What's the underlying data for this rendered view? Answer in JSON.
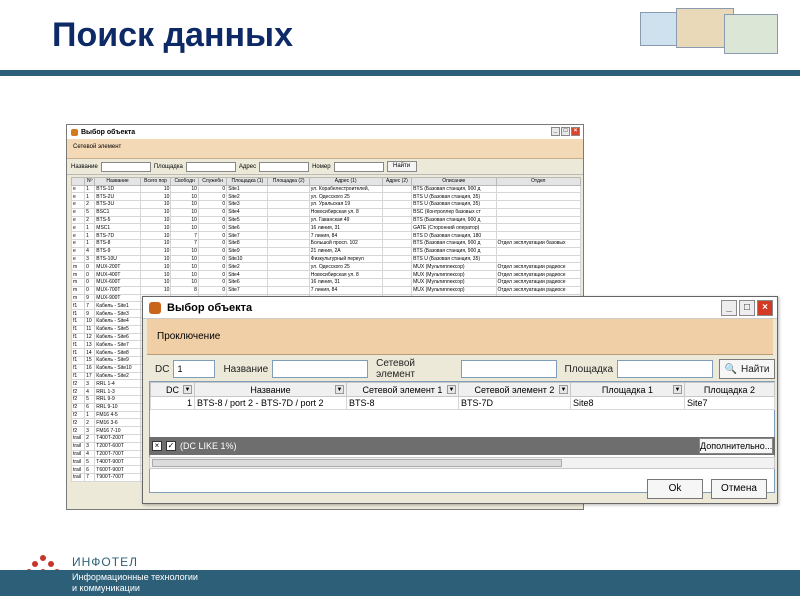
{
  "slide": {
    "title": "Поиск данных"
  },
  "bg_window": {
    "title": "Выбор объекта",
    "subheader": "Сетевой элемент",
    "filters": {
      "name_label": "Название",
      "site_label": "Площадка",
      "address_label": "Адрес",
      "number_label": "Номер",
      "search_label": "Найти"
    },
    "columns": [
      "",
      "Nº",
      "Название",
      "Всего пор",
      "Свободн",
      "Служебн",
      "Площадка (1)",
      "Площадка (2)",
      "Адрес (1)",
      "Адрес (2)",
      "Описание",
      "Отдел"
    ],
    "rows": [
      [
        "e",
        "1",
        "BTS-1D",
        "10",
        "10",
        "0",
        "Site1",
        "",
        "ул. Корабелестроителей,",
        "",
        "BTS (Базовая станция, 900 д",
        ""
      ],
      [
        "e",
        "1",
        "BTS-2U",
        "10",
        "10",
        "0",
        "Site2",
        "",
        "ул. Одесского 25",
        "",
        "BTS U (Базовая станция, 35)",
        ""
      ],
      [
        "e",
        "2",
        "BTS-3U",
        "10",
        "10",
        "0",
        "Site3",
        "",
        "ул. Уральская 19",
        "",
        "BTS U (Базовая станция, 35)",
        ""
      ],
      [
        "e",
        "5",
        "BSC1",
        "10",
        "10",
        "0",
        "Site4",
        "",
        "Новосибирская ул. 8",
        "",
        "BSC (Контроллер базовых ст",
        ""
      ],
      [
        "e",
        "2",
        "BTS-5",
        "10",
        "10",
        "0",
        "Site5",
        "",
        "ул. Гаванская 49",
        "",
        "BTS (Базовая станция, 900 д",
        ""
      ],
      [
        "e",
        "1",
        "MSC1",
        "10",
        "10",
        "0",
        "Site6",
        "",
        "16 линия, 31",
        "",
        "GATE (Сторонний оператор)",
        ""
      ],
      [
        "e",
        "1",
        "BTS-7D",
        "10",
        "7",
        "0",
        "Site7",
        "",
        "7 линия, 84",
        "",
        "BTS D (Базовая станция, 180",
        ""
      ],
      [
        "e",
        "1",
        "BTS-8",
        "10",
        "7",
        "0",
        "Site8",
        "",
        "Большой просп. 102",
        "",
        "BTS (Базовая станция, 900 д",
        "Отдел эксплуатации базовых"
      ],
      [
        "e",
        "4",
        "BTS-9",
        "10",
        "10",
        "0",
        "Site9",
        "",
        "21 линия, 2А",
        "",
        "BTS (Базовая станция, 900 д",
        ""
      ],
      [
        "e",
        "3",
        "BTS-10U",
        "10",
        "10",
        "0",
        "Site10",
        "",
        "Физкультурный переул",
        "",
        "BTS U (Базовая станция, 35)",
        ""
      ],
      [
        "m",
        "0",
        "MUX-200Т",
        "10",
        "10",
        "0",
        "Site2",
        "",
        "ул. Одесского 25",
        "",
        "MUX (Мультиплексор)",
        "Отдел эксплуатации радиосе"
      ],
      [
        "m",
        "0",
        "MUX-400Т",
        "10",
        "10",
        "0",
        "Site4",
        "",
        "Новосибирская ул. 8",
        "",
        "MUX (Мультиплексор)",
        "Отдел эксплуатации радиосе"
      ],
      [
        "m",
        "0",
        "MUX-600Т",
        "10",
        "10",
        "0",
        "Site6",
        "",
        "16 линия, 31",
        "",
        "MUX (Мультиплексор)",
        "Отдел эксплуатации радиосе"
      ],
      [
        "m",
        "0",
        "MUX-700Т",
        "10",
        "8",
        "0",
        "Site7",
        "",
        "7 линия, 84",
        "",
        "MUX (Мультиплексор)",
        "Отдел эксплуатации радиосе"
      ],
      [
        "m",
        "9",
        "MUX-900Т",
        "",
        "",
        "",
        "",
        "",
        "",
        "",
        "",
        ""
      ],
      [
        "f1",
        "7",
        "Кабель - Site1",
        "",
        "",
        "",
        "",
        "",
        "",
        "",
        "",
        ""
      ],
      [
        "f1",
        "9",
        "Кабель - Site3",
        "",
        "",
        "",
        "",
        "",
        "",
        "",
        "",
        ""
      ],
      [
        "f1",
        "10",
        "Кабель - Site4",
        "",
        "",
        "",
        "",
        "",
        "",
        "",
        "",
        ""
      ],
      [
        "f1",
        "11",
        "Кабель - Site5",
        "",
        "",
        "",
        "",
        "",
        "",
        "",
        "",
        ""
      ],
      [
        "f1",
        "12",
        "Кабель - Site6",
        "",
        "",
        "",
        "",
        "",
        "",
        "",
        "",
        ""
      ],
      [
        "f1",
        "13",
        "Кабель - Site7",
        "",
        "",
        "",
        "",
        "",
        "",
        "",
        "",
        ""
      ],
      [
        "f1",
        "14",
        "Кабель - Site8",
        "",
        "",
        "",
        "",
        "",
        "",
        "",
        "",
        ""
      ],
      [
        "f1",
        "15",
        "Кабель - Site9",
        "",
        "",
        "",
        "",
        "",
        "",
        "",
        "",
        ""
      ],
      [
        "f1",
        "16",
        "Кабель - Site10",
        "",
        "",
        "",
        "",
        "",
        "",
        "",
        "",
        ""
      ],
      [
        "f1",
        "17",
        "Кабель - Site2",
        "",
        "",
        "",
        "",
        "",
        "",
        "",
        "",
        ""
      ],
      [
        "f2",
        "3",
        "RRL 1-4",
        "",
        "",
        "",
        "",
        "",
        "",
        "",
        "",
        ""
      ],
      [
        "f2",
        "4",
        "RRL 1-3",
        "",
        "",
        "",
        "",
        "",
        "",
        "",
        "",
        ""
      ],
      [
        "f2",
        "5",
        "RRL 9-9",
        "",
        "",
        "",
        "",
        "",
        "",
        "",
        "",
        ""
      ],
      [
        "f2",
        "6",
        "RRL 9-10",
        "",
        "",
        "",
        "",
        "",
        "",
        "",
        "",
        ""
      ],
      [
        "f2",
        "1",
        "FM16 4-5",
        "",
        "",
        "",
        "",
        "",
        "",
        "",
        "",
        ""
      ],
      [
        "f2",
        "2",
        "FM16 3-6",
        "",
        "",
        "",
        "",
        "",
        "",
        "",
        "",
        ""
      ],
      [
        "f2",
        "3",
        "FM16 7-10",
        "",
        "",
        "",
        "",
        "",
        "",
        "",
        "",
        ""
      ],
      [
        "trail",
        "2",
        "T400Т-200Т",
        "",
        "",
        "",
        "",
        "",
        "",
        "",
        "",
        ""
      ],
      [
        "trail",
        "3",
        "T200Т-600Т",
        "",
        "",
        "",
        "",
        "",
        "",
        "",
        "",
        ""
      ],
      [
        "trail",
        "4",
        "T200Т-700Т",
        "",
        "",
        "",
        "",
        "",
        "",
        "",
        "",
        ""
      ],
      [
        "trail",
        "5",
        "T400Т-900Т",
        "",
        "",
        "",
        "",
        "",
        "",
        "",
        "",
        ""
      ],
      [
        "trail",
        "6",
        "T600Т-900Т",
        "",
        "",
        "",
        "",
        "",
        "",
        "",
        "",
        ""
      ],
      [
        "trail",
        "7",
        "T900Т-700Т",
        "",
        "",
        "",
        "",
        "",
        "",
        "",
        "",
        ""
      ]
    ]
  },
  "dialog": {
    "title": "Выбор объекта",
    "subheader": "Проключение",
    "filters": {
      "dc_label": "DC",
      "dc_value": "1",
      "name_label": "Название",
      "name_value": "",
      "net_element_label": "Сетевой элемент",
      "net_element_value": "",
      "site_label": "Площадка",
      "site_value": "",
      "search_label": "Найти"
    },
    "columns": [
      "DC",
      "Название",
      "Сетевой элемент 1",
      "Сетевой элемент 2",
      "Площадка 1",
      "Площадка 2"
    ],
    "rows": [
      [
        "1",
        "BTS-8 / port 2 - BTS-7D / port 2",
        "BTS-8",
        "BTS-7D",
        "Site8",
        "Site7"
      ]
    ],
    "filter_expression": "(DC LIKE 1%)",
    "more_label": "Дополнительно...",
    "ok_label": "Ok",
    "cancel_label": "Отмена"
  },
  "footer": {
    "brand": "ИНФОТЕЛ",
    "tagline_line1": "Информационные технологии",
    "tagline_line2": "и коммуникации",
    "bar_color": "#2d6078"
  }
}
